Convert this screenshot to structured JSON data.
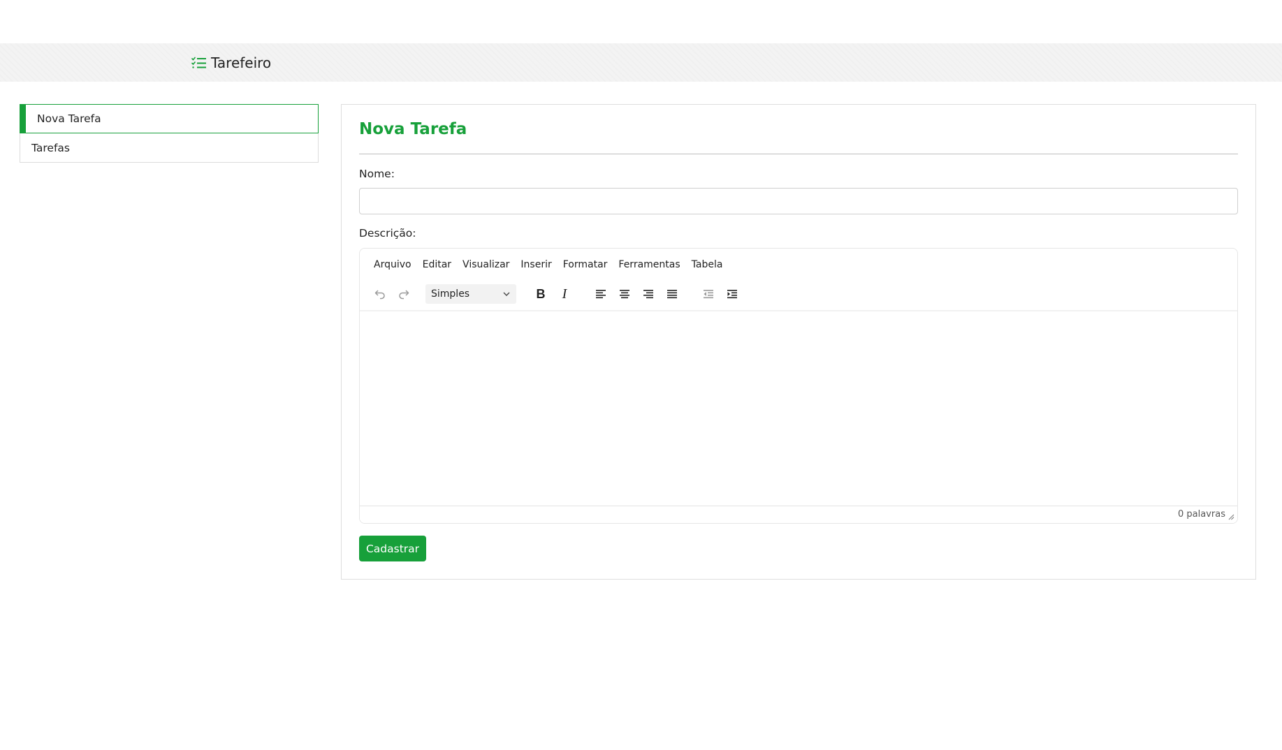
{
  "brand": {
    "name": "Tarefeiro",
    "icon": "task-list-icon",
    "icon_color": "#17a03a"
  },
  "sidebar": {
    "items": [
      {
        "label": "Nova Tarefa",
        "active": true
      },
      {
        "label": "Tarefas",
        "active": false
      }
    ]
  },
  "form": {
    "title": "Nova Tarefa",
    "name_label": "Nome:",
    "name_value": "",
    "name_placeholder": "",
    "description_label": "Descrição:",
    "submit_label": "Cadastrar"
  },
  "editor": {
    "menu": [
      "Arquivo",
      "Editar",
      "Visualizar",
      "Inserir",
      "Formatar",
      "Ferramentas",
      "Tabela"
    ],
    "blocks_value": "Simples",
    "bold_label": "B",
    "italic_label": "I",
    "word_count": "0 palavras",
    "toolbar_icons": [
      "undo-icon",
      "redo-icon",
      "bold-icon",
      "italic-icon",
      "align-left-icon",
      "align-center-icon",
      "align-right-icon",
      "align-justify-icon",
      "outdent-icon",
      "indent-icon"
    ]
  },
  "colors": {
    "accent": "#17a03a",
    "header_bg": "#f3f3f3",
    "border": "#dedede"
  }
}
